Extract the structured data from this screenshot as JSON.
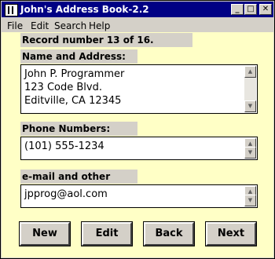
{
  "window": {
    "title": "John's Address Book-2.2"
  },
  "menu": [
    "File",
    "Edit",
    "Search",
    "Help"
  ],
  "record": {
    "label": "Record number 13 of 16."
  },
  "name_address": {
    "label": "Name and Address:",
    "value": "John P. Programmer\n123 Code Blvd.\nEditville, CA 12345"
  },
  "phone": {
    "label": "Phone Numbers:",
    "value": "(101) 555-1234"
  },
  "email": {
    "label": "e-mail and other info:",
    "value": "jpprog@aol.com"
  },
  "buttons": {
    "new": "New",
    "edit": "Edit",
    "back": "Back",
    "next": "Next"
  }
}
